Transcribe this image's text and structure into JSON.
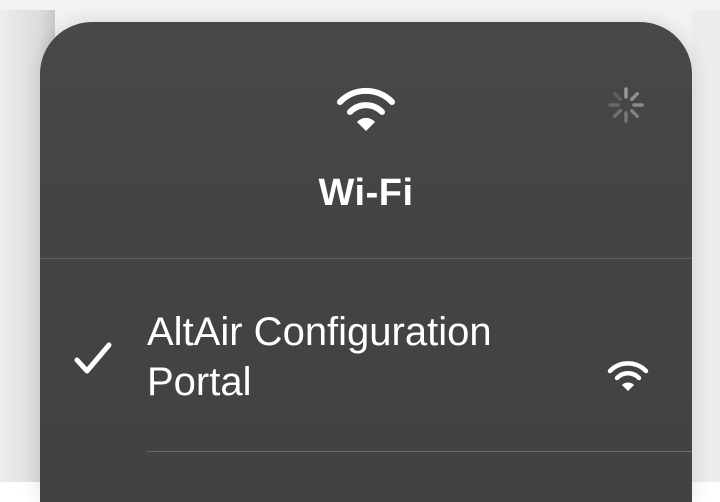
{
  "wifi_panel": {
    "title": "Wi-Fi",
    "header_icon": "wifi-icon",
    "status_icon": "loading-spinner-icon",
    "networks": [
      {
        "name_line1": "AltAir Configuration",
        "name_line2": "Portal",
        "connected": true,
        "check_icon": "checkmark-icon",
        "signal_icon": "wifi-signal-icon"
      }
    ]
  },
  "colors": {
    "panel_background": "#454545",
    "text": "#ffffff",
    "divider": "#5f5f5f",
    "spinner": "#9a9a9a"
  }
}
